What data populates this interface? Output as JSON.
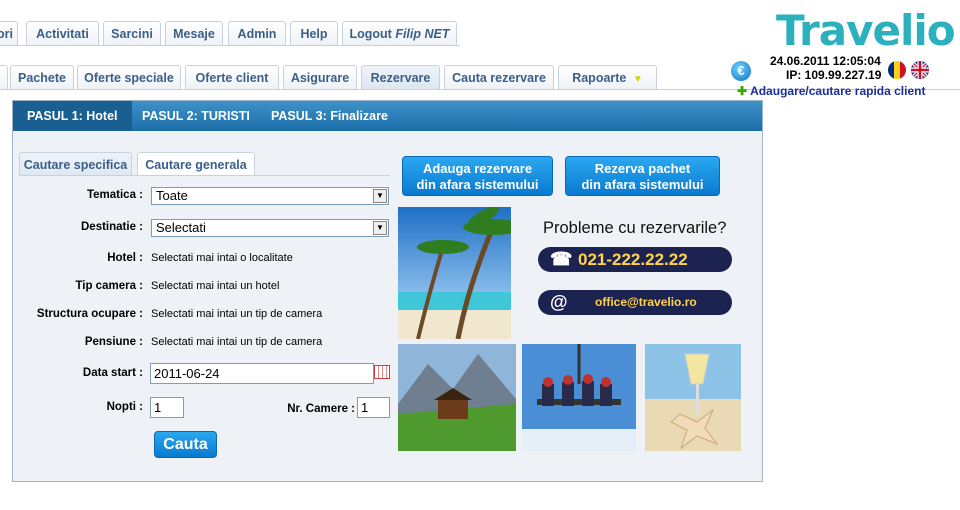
{
  "nav_row1": [
    {
      "label": "ori"
    },
    {
      "label": "Activitati"
    },
    {
      "label": "Sarcini"
    },
    {
      "label": "Mesaje"
    },
    {
      "label": "Admin"
    },
    {
      "label": "Help"
    },
    {
      "label": "Logout",
      "user": "Filip NET"
    }
  ],
  "nav_row2": [
    {
      "label": "Pachete"
    },
    {
      "label": "Oferte speciale"
    },
    {
      "label": "Oferte client"
    },
    {
      "label": "Asigurare"
    },
    {
      "label": "Rezervare"
    },
    {
      "label": "Cauta rezervare"
    },
    {
      "label": "Rapoarte"
    }
  ],
  "header": {
    "logo": "Travelio",
    "datetime": "24.06.2011 12:05:04",
    "ip": "IP: 109.99.227.19",
    "quick_link": "Adaugare/cautare rapida client",
    "currency_icon": "€"
  },
  "steps": [
    {
      "label": "PASUL 1: Hotel"
    },
    {
      "label": "PASUL 2: TURISTI"
    },
    {
      "label": "PASUL 3: Finalizare"
    }
  ],
  "search_tabs": [
    {
      "label": "Cautare specifica"
    },
    {
      "label": "Cautare generala"
    }
  ],
  "form": {
    "tematica_label": "Tematica :",
    "tematica_value": "Toate",
    "destinatie_label": "Destinatie :",
    "destinatie_value": "Selectati",
    "hotel_label": "Hotel :",
    "hotel_value": "Selectati mai intai o localitate",
    "tip_camera_label": "Tip camera :",
    "tip_camera_value": "Selectati mai intai un hotel",
    "structura_label": "Structura ocupare :",
    "structura_value": "Selectati mai intai un tip de camera",
    "pensiune_label": "Pensiune :",
    "pensiune_value": "Selectati mai intai un tip de camera",
    "data_start_label": "Data start :",
    "data_start_value": "2011-06-24",
    "nopti_label": "Nopti :",
    "nopti_value": "1",
    "camere_label": "Nr. Camere :",
    "camere_value": "1",
    "search_button": "Cauta"
  },
  "actions": {
    "add_external_1": "Adauga rezervare",
    "add_external_2": "din afara sistemului",
    "reserve_package_1": "Rezerva pachet",
    "reserve_package_2": "din afara sistemului"
  },
  "support": {
    "title": "Probleme cu rezervarile?",
    "phone": "021-222.22.22",
    "email": "office@travelio.ro"
  },
  "colors": {
    "accent": "#1c6ea8",
    "logo": "#2bb0be",
    "tab_text": "#3a5f88",
    "pill_bg": "#1c2350",
    "pill_text": "#ffd34d"
  }
}
